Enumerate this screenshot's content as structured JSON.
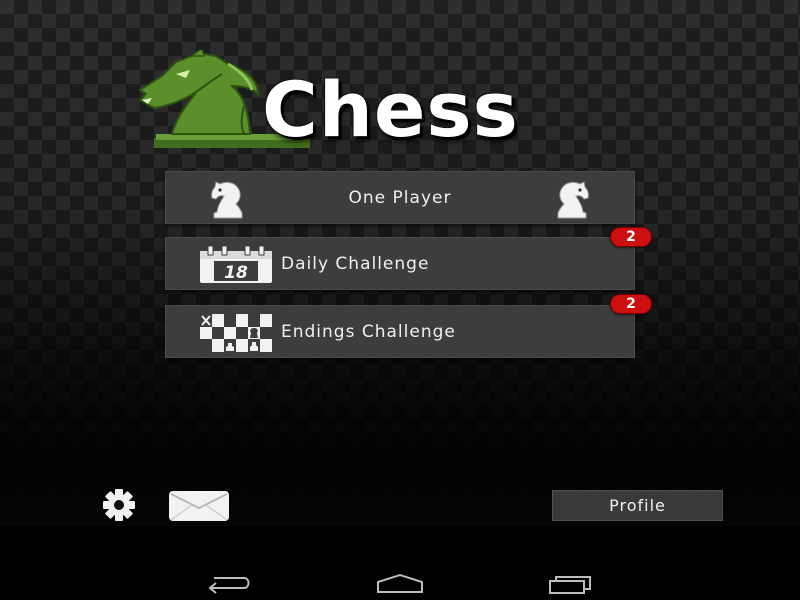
{
  "app": {
    "title": "Chess",
    "logo_icon": "green-knight-logo"
  },
  "menu": {
    "one_player": {
      "label": "One Player",
      "icon": "knight-icon"
    },
    "daily_challenge": {
      "label": "Daily Challenge",
      "icon": "calendar-icon",
      "calendar_day": "18",
      "badge": "2"
    },
    "endings_challenge": {
      "label": "Endings Challenge",
      "icon": "chess-board-icon",
      "badge": "2"
    }
  },
  "footer": {
    "settings_icon": "gear-icon",
    "mail_icon": "envelope-icon",
    "profile_label": "Profile"
  },
  "system_nav": {
    "back_icon": "back-icon",
    "home_icon": "home-icon",
    "recents_icon": "recent-apps-icon"
  },
  "colors": {
    "logo_green": "#5a8f2c",
    "badge_red": "#cc1010",
    "button_bg": "#3d3d3d"
  }
}
